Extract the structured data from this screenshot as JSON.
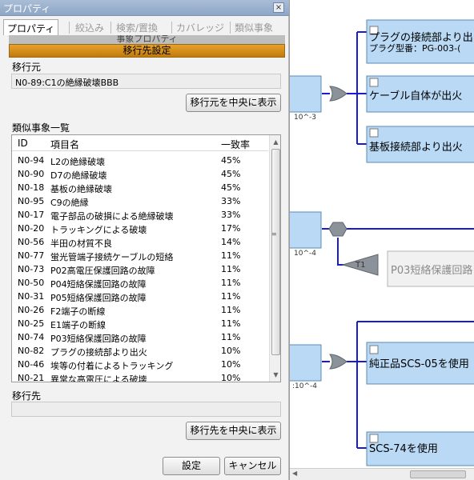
{
  "window": {
    "title": "プロパティ",
    "close_glyph": "×"
  },
  "tabs": [
    "プロパティ",
    "絞込み",
    "検索/置換",
    "カバレッジ",
    "類似事象"
  ],
  "ghost_header": "事象プロパティ",
  "banner": "移行先設定",
  "source": {
    "label": "移行元",
    "value": "N0-89:C1の絶縁破壊BBB",
    "center_button": "移行元を中央に表示"
  },
  "similar": {
    "label": "類似事象一覧",
    "columns": [
      "ID",
      "項目名",
      "一致率"
    ],
    "rows": [
      [
        "N0-94",
        "L2の絶縁破壊",
        "45%"
      ],
      [
        "N0-90",
        "D7の絶縁破壊",
        "45%"
      ],
      [
        "N0-18",
        "基板の絶縁破壊",
        "45%"
      ],
      [
        "N0-95",
        "C9の絶縁",
        "33%"
      ],
      [
        "N0-17",
        "電子部品の破損による絶縁破壊",
        "33%"
      ],
      [
        "N0-20",
        "トラッキングによる破壊",
        "17%"
      ],
      [
        "N0-56",
        "半田の材質不良",
        "14%"
      ],
      [
        "N0-77",
        "蛍光管端子接続ケーブルの短絡",
        "11%"
      ],
      [
        "N0-73",
        "P02高電圧保護回路の故障",
        "11%"
      ],
      [
        "N0-50",
        "P04短絡保護回路の故障",
        "11%"
      ],
      [
        "N0-31",
        "P05短絡保護回路の故障",
        "11%"
      ],
      [
        "N0-26",
        "F2端子の断線",
        "11%"
      ],
      [
        "N0-25",
        "E1端子の断線",
        "11%"
      ],
      [
        "N0-74",
        "P03短絡保護回路の故障",
        "11%"
      ],
      [
        "N0-82",
        "プラグの接続部より出火",
        "10%"
      ],
      [
        "N0-46",
        "埃等の付着によるトラッキング",
        "10%"
      ],
      [
        "N0-21",
        "異常な高電圧による破壊",
        "10%"
      ]
    ]
  },
  "target": {
    "label": "移行先",
    "value": "",
    "center_button": "移行先を中央に表示"
  },
  "footer": {
    "ok": "設定",
    "cancel": "キャンセル"
  },
  "diagram": {
    "nodes": [
      {
        "line1": "プラグの接続部より出",
        "line2": "プラグ型番：PG-003-("
      },
      {
        "line1": "ケーブル自体が出火"
      },
      {
        "line1": "基板接続部より出火"
      },
      {
        "line1": "P03短絡保護回路"
      },
      {
        "line1": "純正品SCS-05を使用"
      },
      {
        "line1": "SCS-74を使用"
      }
    ],
    "tags": [
      "10^-3",
      "10^-4",
      ":10^-4"
    ],
    "transfer_label": "T1"
  },
  "colors": {
    "node_fill": "#b9d9f4",
    "node_border": "#5b8bb4",
    "wire": "#1a1ad0",
    "gate": "#8b9299",
    "banner": "#d48c1c"
  }
}
